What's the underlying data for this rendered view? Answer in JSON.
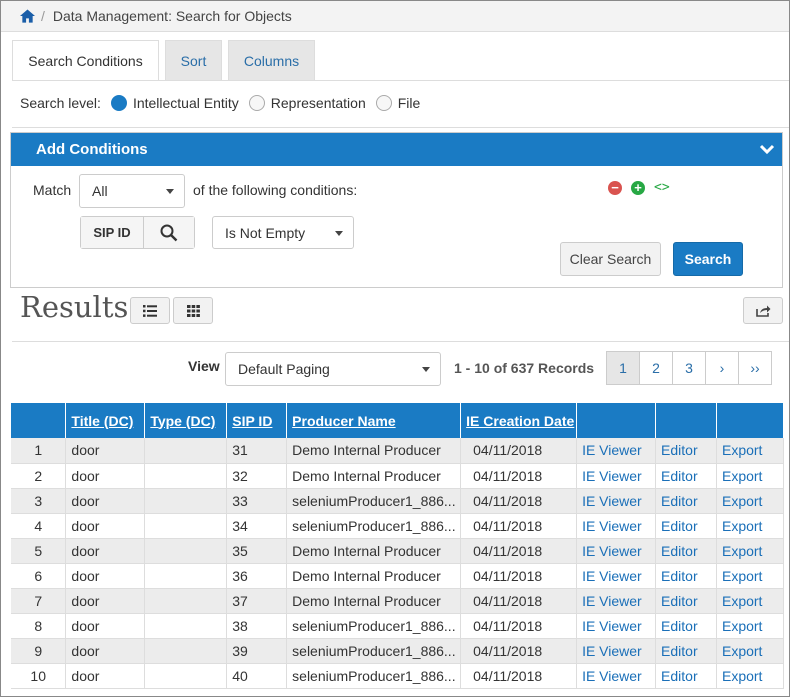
{
  "breadcrumb": {
    "separator": "/",
    "title": "Data Management: Search for Objects"
  },
  "tabs": [
    {
      "label": "Search Conditions",
      "active": true
    },
    {
      "label": "Sort",
      "active": false
    },
    {
      "label": "Columns",
      "active": false
    }
  ],
  "search_level": {
    "label": "Search level:",
    "options": [
      {
        "label": "Intellectual Entity",
        "checked": true
      },
      {
        "label": "Representation",
        "checked": false
      },
      {
        "label": "File",
        "checked": false
      }
    ]
  },
  "conditions": {
    "header": "Add Conditions",
    "match_label": "Match",
    "match_value": "All",
    "following_text": "of the following conditions:",
    "field_label": "SIP ID",
    "operator_value": "Is Not Empty",
    "clear_button": "Clear Search",
    "search_button": "Search"
  },
  "results": {
    "title": "Results",
    "view_label": "View",
    "view_value": "Default Paging",
    "records": "1 - 10 of 637 Records",
    "pages": [
      "1",
      "2",
      "3",
      "›",
      "››"
    ],
    "current_page": "1"
  },
  "table": {
    "headers": [
      "",
      "Title (DC)",
      "Type (DC)",
      "SIP ID",
      "Producer Name",
      "IE Creation Date",
      "",
      "",
      ""
    ],
    "rows": [
      [
        "1",
        "door",
        "",
        "31",
        "Demo Internal Producer",
        "04/11/2018",
        "IE Viewer",
        "Editor",
        "Export"
      ],
      [
        "2",
        "door",
        "",
        "32",
        "Demo Internal Producer",
        "04/11/2018",
        "IE Viewer",
        "Editor",
        "Export"
      ],
      [
        "3",
        "door",
        "",
        "33",
        "seleniumProducer1_886...",
        "04/11/2018",
        "IE Viewer",
        "Editor",
        "Export"
      ],
      [
        "4",
        "door",
        "",
        "34",
        "seleniumProducer1_886...",
        "04/11/2018",
        "IE Viewer",
        "Editor",
        "Export"
      ],
      [
        "5",
        "door",
        "",
        "35",
        "Demo Internal Producer",
        "04/11/2018",
        "IE Viewer",
        "Editor",
        "Export"
      ],
      [
        "6",
        "door",
        "",
        "36",
        "Demo Internal Producer",
        "04/11/2018",
        "IE Viewer",
        "Editor",
        "Export"
      ],
      [
        "7",
        "door",
        "",
        "37",
        "Demo Internal Producer",
        "04/11/2018",
        "IE Viewer",
        "Editor",
        "Export"
      ],
      [
        "8",
        "door",
        "",
        "38",
        "seleniumProducer1_886...",
        "04/11/2018",
        "IE Viewer",
        "Editor",
        "Export"
      ],
      [
        "9",
        "door",
        "",
        "39",
        "seleniumProducer1_886...",
        "04/11/2018",
        "IE Viewer",
        "Editor",
        "Export"
      ],
      [
        "10",
        "door",
        "",
        "40",
        "seleniumProducer1_886...",
        "04/11/2018",
        "IE Viewer",
        "Editor",
        "Export"
      ]
    ]
  },
  "icons": {
    "home": "home-icon",
    "chevron": "chevron-down-icon",
    "remove": "minus-circle-icon",
    "add": "plus-circle-icon",
    "code": "code-icon",
    "search": "search-icon",
    "list": "list-view-icon",
    "grid": "grid-view-icon",
    "export": "share-icon"
  },
  "colors": {
    "primary": "#1a7bc4",
    "remove": "#d9534f",
    "add": "#27a844",
    "link": "#1a6fb8"
  }
}
